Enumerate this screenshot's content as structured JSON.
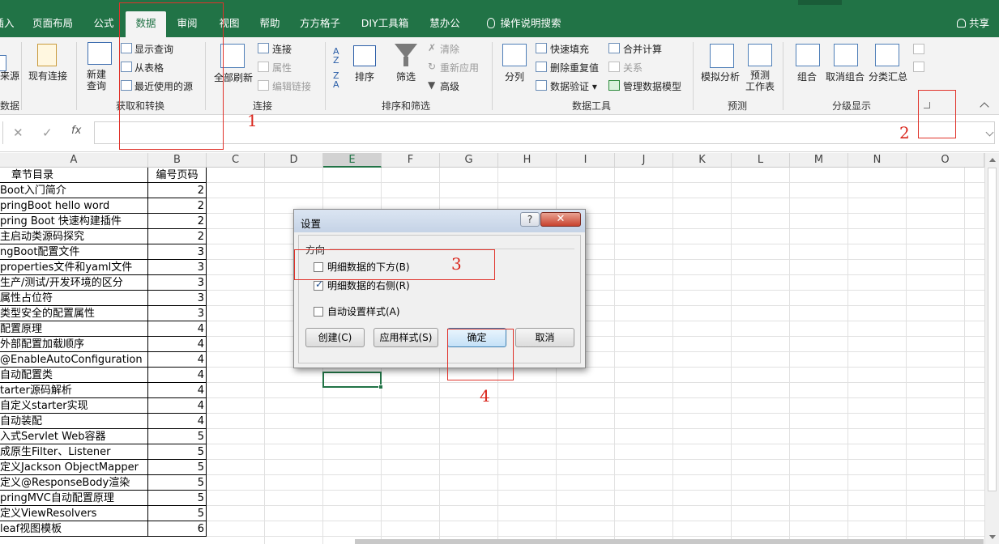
{
  "ribbon_tabs": [
    {
      "label": "插入",
      "visible_text": "插入"
    },
    {
      "label": "页面布局"
    },
    {
      "label": "公式"
    },
    {
      "label": "数据"
    },
    {
      "label": "审阅"
    },
    {
      "label": "视图"
    },
    {
      "label": "帮助"
    },
    {
      "label": "方方格子"
    },
    {
      "label": "DIY工具箱"
    },
    {
      "label": "慧办公"
    },
    {
      "label": "操作说明搜索"
    }
  ],
  "share_label": "共享",
  "ribbon": {
    "get_external": {
      "partial1": "来源",
      "partial2": "数据",
      "existing": "现有连接"
    },
    "get_transform": {
      "name": "获取和转换",
      "new_query": "新建\n查询",
      "show_queries": "显示查询",
      "from_table": "从表格",
      "recent_sources": "最近使用的源"
    },
    "connections": {
      "name": "连接",
      "refresh_all": "全部刷新",
      "connections": "连接",
      "properties": "属性",
      "edit_links": "编辑链接"
    },
    "sort_filter": {
      "name": "排序和筛选",
      "sort": "排序",
      "filter": "筛选",
      "clear": "清除",
      "reapply": "重新应用",
      "advanced": "高级"
    },
    "data_tools": {
      "name": "数据工具",
      "text_to_columns": "分列",
      "flash_fill": "快速填充",
      "remove_duplicates": "删除重复值",
      "data_validation": "数据验证",
      "consolidate": "合并计算",
      "relationships": "关系",
      "manage_model": "管理数据模型"
    },
    "forecast": {
      "name": "预测",
      "what_if": "模拟分析",
      "forecast_sheet": "预测\n工作表"
    },
    "outline": {
      "name": "分级显示",
      "group": "组合",
      "ungroup": "取消组合",
      "subtotal": "分类汇总"
    }
  },
  "formula_bar": {
    "cancel": "✕",
    "enter": "✓",
    "fx": "fx"
  },
  "columns": [
    "A",
    "B",
    "C",
    "D",
    "E",
    "F",
    "G",
    "H",
    "I",
    "J",
    "K",
    "L",
    "M",
    "N",
    "O"
  ],
  "rows": [
    {
      "a": "章节目录",
      "b": "编号页码"
    },
    {
      "a": "Boot入门简介",
      "b": "2"
    },
    {
      "a": "pringBoot  hello word",
      "b": "2"
    },
    {
      "a": "pring Boot 快速构建插件",
      "b": "2"
    },
    {
      "a": "主启动类源码探究",
      "b": "2"
    },
    {
      "a": "ngBoot配置文件",
      "b": "3"
    },
    {
      "a": "properties文件和yaml文件",
      "b": "3"
    },
    {
      "a": "生产/测试/开发环境的区分",
      "b": "3"
    },
    {
      "a": "属性占位符",
      "b": "3"
    },
    {
      "a": "类型安全的配置属性",
      "b": "3"
    },
    {
      "a": "配置原理",
      "b": "4"
    },
    {
      "a": "外部配置加载顺序",
      "b": "4"
    },
    {
      "a": "@EnableAutoConfiguration",
      "b": "4"
    },
    {
      "a": "自动配置类",
      "b": "4"
    },
    {
      "a": "tarter源码解析",
      "b": "4"
    },
    {
      "a": "自定义starter实现",
      "b": "4"
    },
    {
      "a": "自动装配",
      "b": "4"
    },
    {
      "a": "入式Servlet Web容器",
      "b": "5"
    },
    {
      "a": "成原生Filter、Listener",
      "b": "5"
    },
    {
      "a": "定义Jackson ObjectMapper",
      "b": "5"
    },
    {
      "a": "定义@ResponseBody渲染",
      "b": "5"
    },
    {
      "a": "pringMVC自动配置原理",
      "b": "5"
    },
    {
      "a": "定义ViewResolvers",
      "b": "5"
    },
    {
      "a": "leaf视图模板",
      "b": "6"
    }
  ],
  "dialog": {
    "title": "设置",
    "help": "?",
    "close": "✕",
    "group_label": "方向",
    "options": [
      {
        "label": "明细数据的下方(B)",
        "checked": false
      },
      {
        "label": "明细数据的右侧(R)",
        "checked": true
      },
      {
        "label": "自动设置样式(A)",
        "checked": false
      }
    ],
    "buttons": {
      "create": "创建(C)",
      "apply_styles": "应用样式(S)",
      "ok": "确定",
      "cancel": "取消"
    }
  },
  "annotations": [
    "1",
    "2",
    "3",
    "4"
  ],
  "colors": {
    "excel_green": "#217346",
    "annotation_red": "#e0322a"
  }
}
